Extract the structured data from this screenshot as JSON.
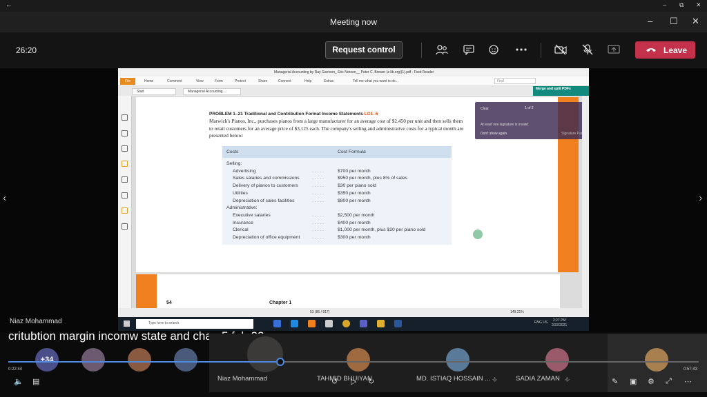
{
  "window": {
    "title": "Meeting now"
  },
  "toolbar": {
    "timer": "26:20",
    "request_control": "Request control",
    "leave": "Leave"
  },
  "foxit": {
    "title": "Managerial Accounting by Ray Garrison_ Eric Noreen__ Peter C. Brewer (z-lib.org)(1).pdf - Foxit Reader",
    "ribbon": [
      "File",
      "Home",
      "Comment",
      "View",
      "Form",
      "Protect",
      "Share",
      "Connect",
      "Help",
      "Extras"
    ],
    "tell_me": "Tell me what you want to do...",
    "find_placeholder": "Find",
    "tabs": [
      "Start",
      "Managerial Accounting ..."
    ],
    "merge": "Merge and split PDFs",
    "signature_panel": {
      "clear": "Clear",
      "page_of": "1 of 2",
      "message": "At least one signature is invalid.",
      "dont_show": "Don't show again",
      "panel": "Signature Panel"
    },
    "status": {
      "page": "53 (86 / 817)",
      "zoom": "149.21%"
    }
  },
  "document": {
    "heading": "PROBLEM 1–21 Traditional and Contribution Format Income Statements",
    "lo": "LO1–6",
    "body": "Marwick's Pianos, Inc., purchases pianos from a large manufacturer for an average cost of $2,450 per unit and then sells them to retail customers for an average price of $3,125 each. The company's selling and administrative costs for a typical month are presented below:",
    "table": {
      "headers": [
        "Costs",
        "Cost Formula"
      ],
      "rows": [
        {
          "cost": "Selling:",
          "formula": "",
          "indent": false
        },
        {
          "cost": "Advertising",
          "formula": "$700 per month",
          "indent": true
        },
        {
          "cost": "Sales salaries and commissions",
          "formula": "$950 per month, plus 8% of sales",
          "indent": true
        },
        {
          "cost": "Delivery of pianos to customers",
          "formula": "$30 per piano sold",
          "indent": true
        },
        {
          "cost": "Utilities",
          "formula": "$350 per month",
          "indent": true
        },
        {
          "cost": "Depreciation of sales facilities",
          "formula": "$800 per month",
          "indent": true
        },
        {
          "cost": "Administrative:",
          "formula": "",
          "indent": false
        },
        {
          "cost": "Executive salaries",
          "formula": "$2,500 per month",
          "indent": true
        },
        {
          "cost": "Insurance",
          "formula": "$400 per month",
          "indent": true
        },
        {
          "cost": "Clerical",
          "formula": "$1,000 per month, plus $20 per piano sold",
          "indent": true
        },
        {
          "cost": "Depreciation of office equipment",
          "formula": "$300 per month",
          "indent": true
        }
      ]
    },
    "page_number": "54",
    "chapter": "Chapter 1"
  },
  "taskbar": {
    "search": "Type here to search",
    "lang": "ENG US",
    "time": "2:27 PM",
    "date": "2/22/2021"
  },
  "presenter": "Niaz Mohammad",
  "caption": "critubtion margin incomw state and chap 5 feb 22",
  "participants": {
    "more": "+34",
    "names": [
      "Niaz Mohammad",
      "TAHMID BHUIYAN",
      "MD. ISTIAQ HOSSAIN ...",
      "SADIA ZAMAN"
    ]
  },
  "playback": {
    "elapsed": "0:22:44",
    "total": "0:57:43",
    "progress": 0.394
  },
  "colors": {
    "accent": "#4f8be0",
    "leave": "#c4314b",
    "foxit_orange": "#f07f1d"
  }
}
